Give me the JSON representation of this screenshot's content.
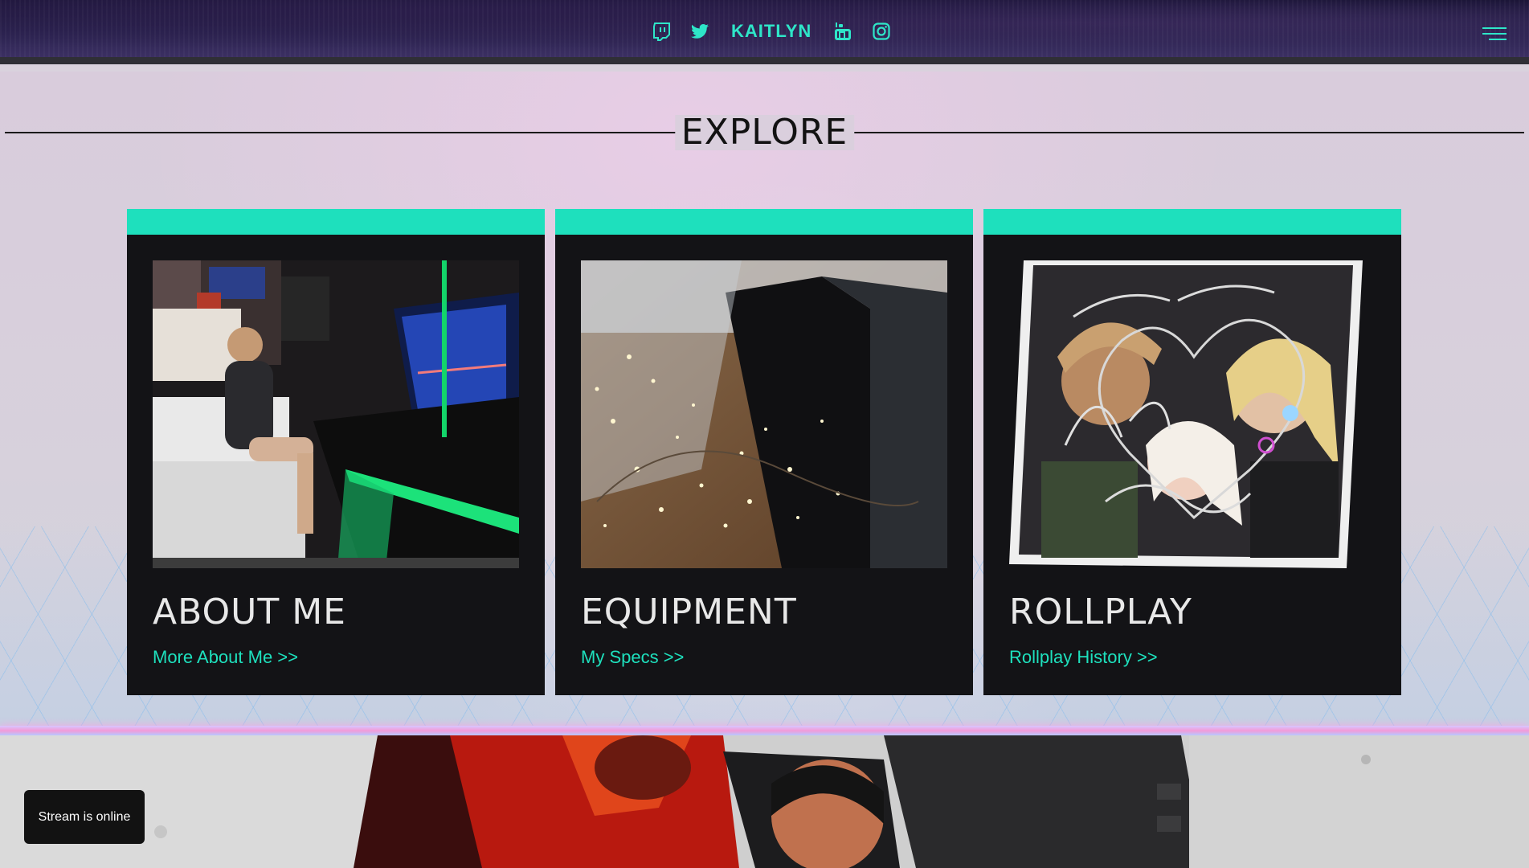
{
  "header": {
    "brand": "KAITLYN",
    "social": [
      {
        "icon": "twitch-icon"
      },
      {
        "icon": "twitter-icon"
      },
      {
        "icon": "youtube-icon"
      },
      {
        "icon": "instagram-icon"
      }
    ],
    "menu_icon": "hamburger-menu-icon"
  },
  "explore": {
    "title": "EXPLORE",
    "cards": [
      {
        "title": "ABOUT ME",
        "link": "More About Me >>"
      },
      {
        "title": "EQUIPMENT",
        "link": "My Specs >>"
      },
      {
        "title": "ROLLPLAY",
        "link": "Rollplay History >>"
      }
    ]
  },
  "status": {
    "toast": "Stream is online"
  },
  "colors": {
    "accent": "#1ee0bd",
    "card_bg": "#131316",
    "header_bg": "#2b2350"
  }
}
